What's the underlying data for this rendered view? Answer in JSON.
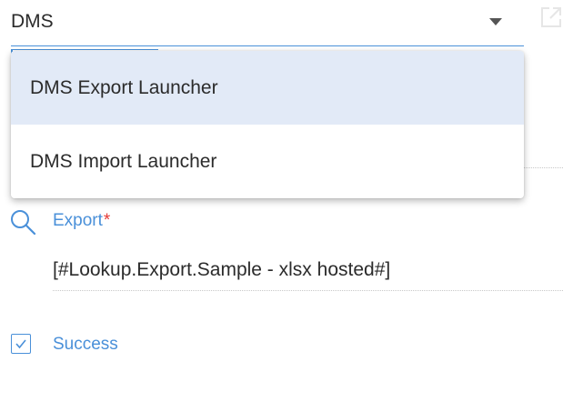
{
  "dms_select": {
    "value": "DMS"
  },
  "dropdown": {
    "items": [
      {
        "label": "DMS Export Launcher",
        "highlighted": true
      },
      {
        "label": "DMS Import Launcher",
        "highlighted": false
      }
    ]
  },
  "export_field": {
    "label": "Export",
    "required_marker": "*",
    "value": "[#Lookup.Export.Sample - xlsx hosted#]"
  },
  "success": {
    "label": "Success",
    "checked": true
  },
  "colors": {
    "accent": "#4a90d9",
    "required": "#e53935",
    "highlight": "#e2eaf7",
    "text": "#2b2b2b"
  },
  "icons": [
    "chevron-down-icon",
    "external-link-icon",
    "search-icon",
    "checkmark-icon"
  ]
}
